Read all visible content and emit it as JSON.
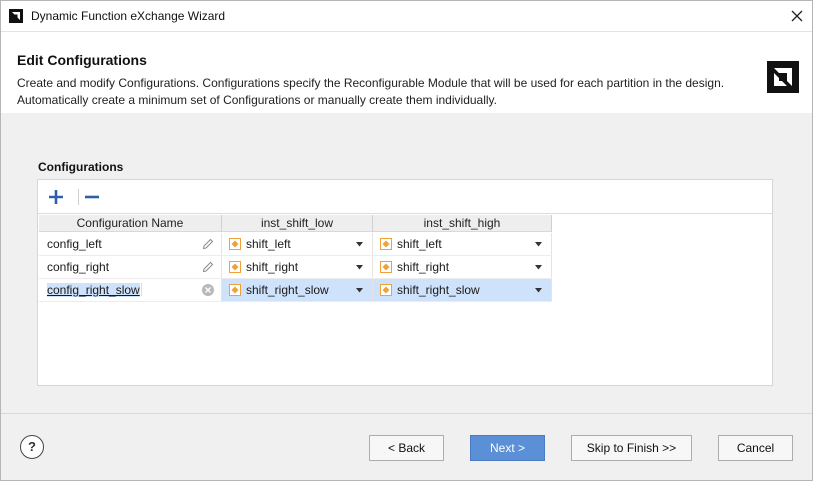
{
  "window": {
    "title": "Dynamic Function eXchange Wizard",
    "app_icon": "amd-app-icon",
    "close_icon": "close-icon"
  },
  "header": {
    "title": "Edit Configurations",
    "description_line1": "Create and modify Configurations. Configurations specify the Reconfigurable Module that will be used for each partition in the design.",
    "description_line2": "Automatically create a minimum set of Configurations or manually create them individually.",
    "logo": "amd-logo-icon"
  },
  "section": {
    "label": "Configurations"
  },
  "toolbar": {
    "add_icon": "plus-icon",
    "remove_icon": "minus-icon"
  },
  "table": {
    "columns": [
      "Configuration Name",
      "inst_shift_low",
      "inst_shift_high"
    ],
    "rows": [
      {
        "name": "config_left",
        "low": "shift_left",
        "high": "shift_left",
        "selected": false
      },
      {
        "name": "config_right",
        "low": "shift_right",
        "high": "shift_right",
        "selected": false
      },
      {
        "name": "config_right_slow",
        "low": "shift_right_slow",
        "high": "shift_right_slow",
        "selected": true
      }
    ]
  },
  "footer": {
    "help_label": "?",
    "back_label": "< Back",
    "next_label": "Next >",
    "skip_label": "Skip to Finish >>",
    "cancel_label": "Cancel"
  },
  "colors": {
    "accent": "#5b8fd6",
    "selection": "#cfe2fb",
    "module_icon": "#f0a23a"
  }
}
